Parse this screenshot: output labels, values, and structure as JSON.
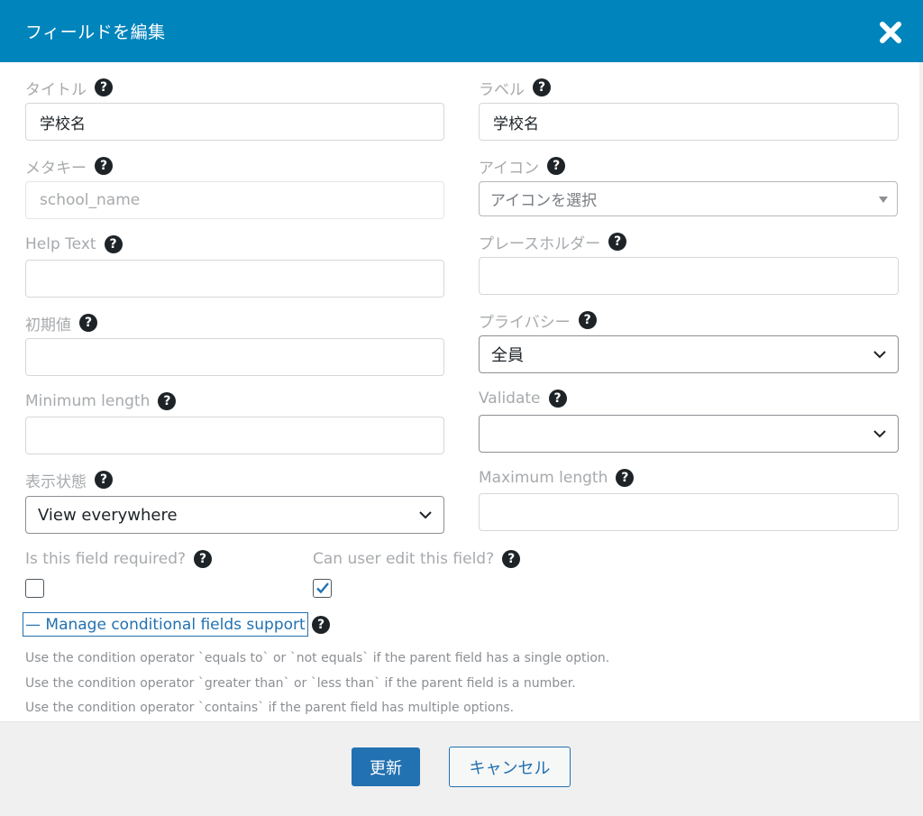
{
  "dialog": {
    "title": "フィールドを編集",
    "close_icon": "close-icon",
    "accent_color": "#0084bc"
  },
  "fields": {
    "title": {
      "label": "タイトル",
      "value": "学校名"
    },
    "meta_key": {
      "label": "メタキー",
      "placeholder": "school_name"
    },
    "help_text": {
      "label": "Help Text",
      "value": ""
    },
    "default_value": {
      "label": "初期値",
      "value": ""
    },
    "min_length": {
      "label": "Minimum length",
      "value": ""
    },
    "visibility": {
      "label": "表示状態",
      "selected": "View everywhere"
    },
    "field_label": {
      "label": "ラベル",
      "value": "学校名"
    },
    "icon": {
      "label": "アイコン",
      "selected": "アイコンを選択"
    },
    "placeholder": {
      "label": "プレースホルダー",
      "value": ""
    },
    "privacy": {
      "label": "プライバシー",
      "selected": "全員"
    },
    "validate": {
      "label": "Validate",
      "selected": ""
    },
    "max_length": {
      "label": "Maximum length",
      "value": ""
    }
  },
  "required": {
    "label": "Is this field required?",
    "checked": false
  },
  "editable": {
    "label": "Can user edit this field?",
    "checked": true
  },
  "conditional": {
    "link_label": "— Manage conditional fields support",
    "notes": [
      "Use the condition operator `equals to` or `not equals` if the parent field has a single option.",
      "Use the condition operator `greater than` or `less than` if the parent field is a number.",
      "Use the condition operator `contains` if the parent field has multiple options."
    ]
  },
  "footer": {
    "update_label": "更新",
    "cancel_label": "キャンセル"
  },
  "help_glyph": "?"
}
